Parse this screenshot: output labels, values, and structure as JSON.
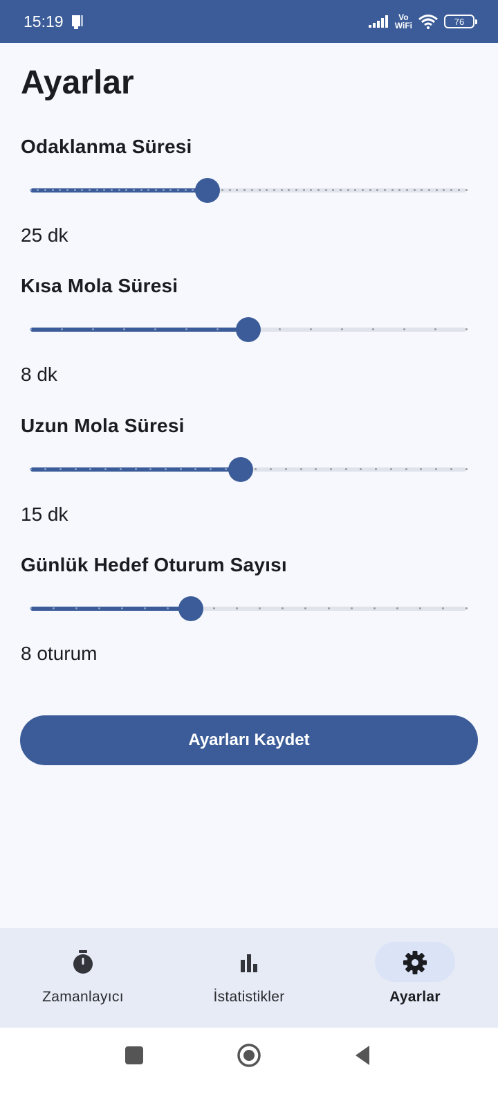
{
  "status_bar": {
    "time": "15:19",
    "vo_wifi_top": "Vo",
    "vo_wifi_bottom": "WiFi",
    "battery": "76"
  },
  "page": {
    "title": "Ayarlar"
  },
  "settings": [
    {
      "label": "Odaklanma Süresi",
      "value_text": "25 dk",
      "value": 25,
      "min": 1,
      "max": 60
    },
    {
      "label": "Kısa Mola Süresi",
      "value_text": "8 dk",
      "value": 8,
      "min": 1,
      "max": 15
    },
    {
      "label": "Uzun Mola Süresi",
      "value_text": "15 dk",
      "value": 15,
      "min": 1,
      "max": 30
    },
    {
      "label": "Günlük Hedef Oturum Sayısı",
      "value_text": "8 oturum",
      "value": 8,
      "min": 1,
      "max": 20
    }
  ],
  "save_button": {
    "label": "Ayarları Kaydet"
  },
  "bottom_nav": [
    {
      "label": "Zamanlayıcı",
      "icon": "stopwatch-icon",
      "active": false
    },
    {
      "label": "İstatistikler",
      "icon": "bar-chart-icon",
      "active": false
    },
    {
      "label": "Ayarlar",
      "icon": "gear-icon",
      "active": true
    }
  ],
  "colors": {
    "primary": "#3b5c98",
    "background": "#f6f8fd",
    "track_inactive": "#e0e3ea",
    "nav_background": "#e6ebf5",
    "nav_active_pill": "#dbe3f7"
  }
}
